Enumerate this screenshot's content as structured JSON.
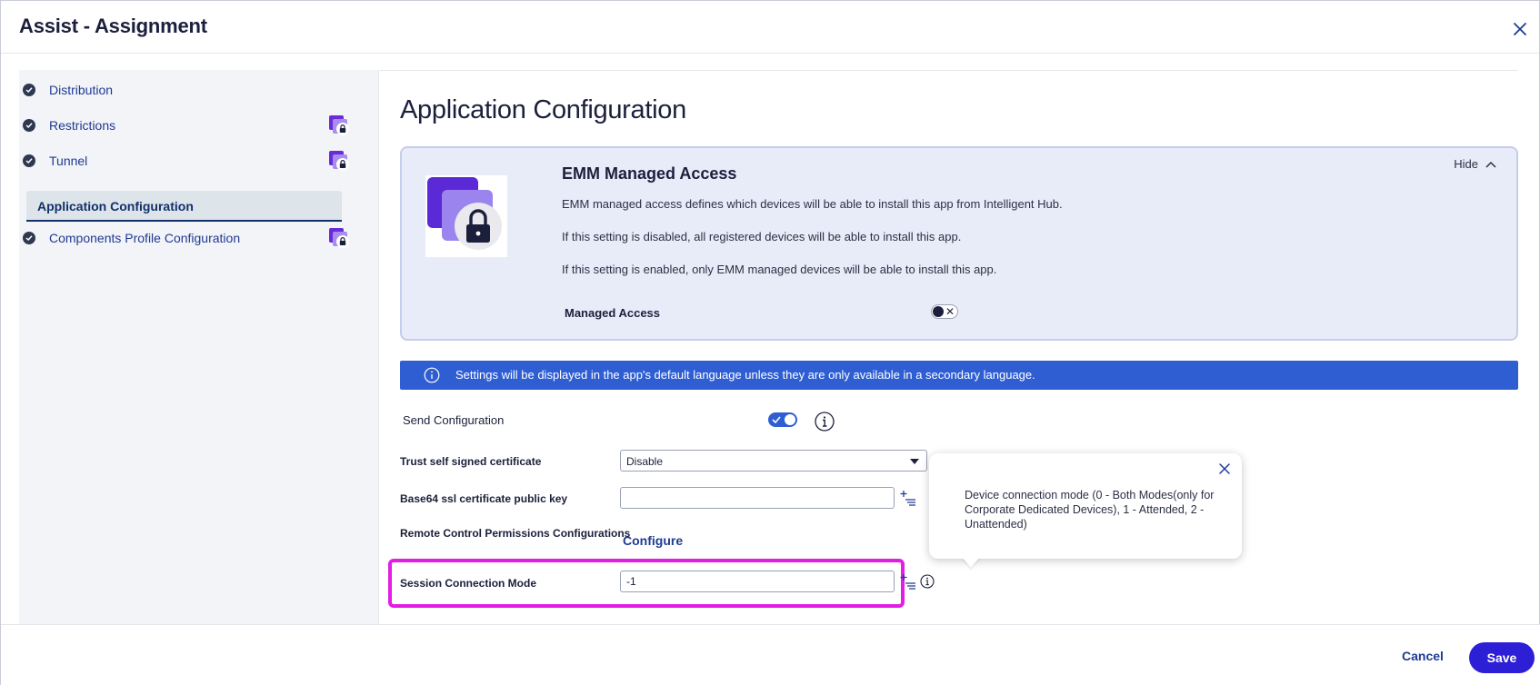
{
  "window": {
    "title": "Assist - Assignment",
    "close_icon": "close-icon"
  },
  "sidebar": {
    "items": [
      {
        "label": "Distribution",
        "completed": true,
        "locked": false
      },
      {
        "label": "Restrictions",
        "completed": true,
        "locked": true
      },
      {
        "label": "Tunnel",
        "completed": true,
        "locked": true
      },
      {
        "label": "Application Configuration",
        "completed": false,
        "locked": false,
        "active": true
      },
      {
        "label": "Components Profile Configuration",
        "completed": true,
        "locked": true
      }
    ]
  },
  "main": {
    "page_title": "Application Configuration",
    "emm_card": {
      "heading": "EMM Managed Access",
      "hide_label": "Hide",
      "paragraphs": [
        "EMM managed access defines which devices will be able to install this app from Intelligent Hub.",
        "If this setting is disabled, all registered devices will be able to install this app.",
        "If this setting is enabled, only EMM managed devices will be able to install this app."
      ],
      "managed_access_label": "Managed Access",
      "managed_access_enabled": false
    },
    "info_banner": {
      "text": "Settings will be displayed in the app's default language unless they are only available in a secondary language."
    },
    "send_configuration": {
      "label": "Send Configuration",
      "enabled": true
    },
    "fields": {
      "trust_cert": {
        "label": "Trust self signed certificate",
        "value": "Disable"
      },
      "base64_key": {
        "label": "Base64 ssl certificate public key",
        "value": ""
      },
      "remote_control": {
        "label": "Remote Control Permissions Configurations",
        "link": "Configure"
      },
      "session_mode": {
        "label": "Session Connection Mode",
        "value": "-1"
      }
    },
    "tooltip": {
      "text": "Device connection mode (0 - Both Modes(only for Corporate Dedicated Devices), 1 - Attended, 2 - Unattended)"
    }
  },
  "footer": {
    "cancel_label": "Cancel",
    "save_label": "Save"
  },
  "colors": {
    "accent": "#2f5ed2",
    "primary_button": "#2d1fd6",
    "highlight": "#e21de4",
    "nav_text": "#1f3a93"
  }
}
